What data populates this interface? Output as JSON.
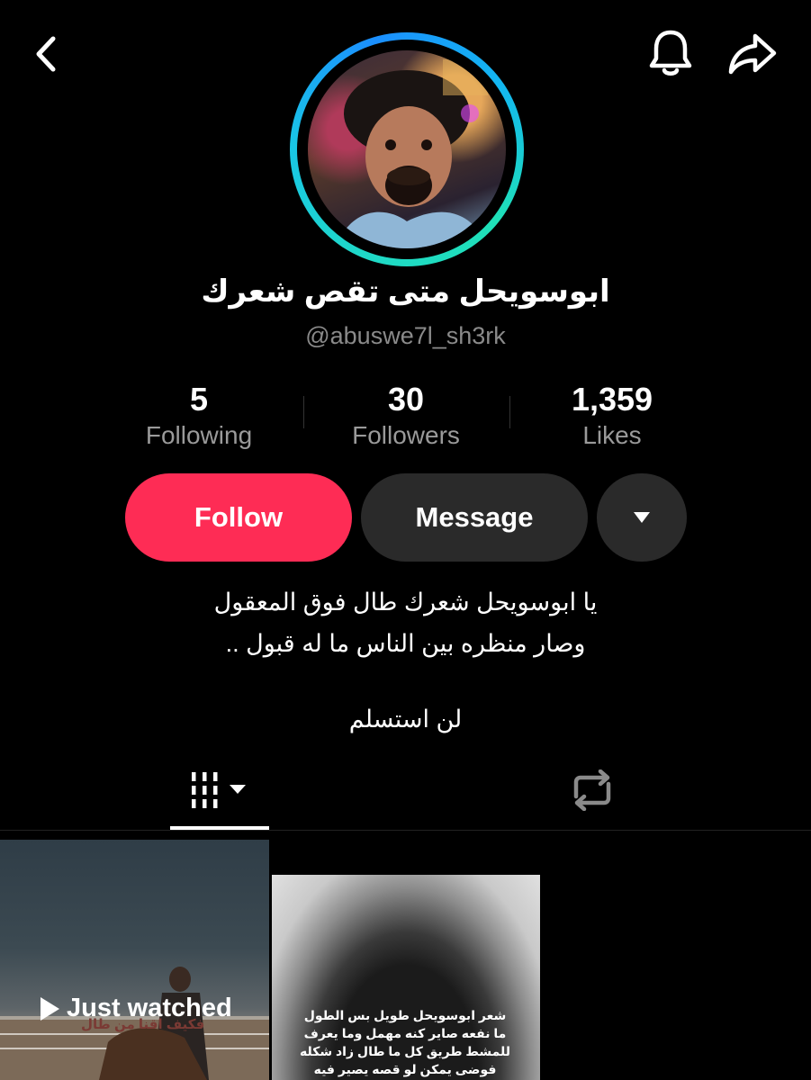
{
  "header": {
    "back_icon": "chevron-left-icon",
    "bell_icon": "bell-icon",
    "share_icon": "share-arrow-icon"
  },
  "profile": {
    "display_name": "ابوسويحل متى تقص شعرك",
    "handle": "@abuswe7l_sh3rk"
  },
  "stats": [
    {
      "value": "5",
      "label": "Following"
    },
    {
      "value": "30",
      "label": "Followers"
    },
    {
      "value": "1,359",
      "label": "Likes"
    }
  ],
  "actions": {
    "follow_label": "Follow",
    "message_label": "Message",
    "more_icon": "caret-down-icon"
  },
  "bio": {
    "line1": "يا ابوسويحل شعرك طال فوق المعقول",
    "line2": "وصار منظره بين الناس ما له قبول ..",
    "line3": "لن استسلم"
  },
  "tabs": {
    "videos_icon": "video-grid-icon",
    "reposts_icon": "repost-icon"
  },
  "videos": {
    "just_watched_label": "Just watched",
    "thumb1_overlay": "فكيف اقنا من طال",
    "thumb2_caption": [
      "شعر ابوسويحل طويل بس الطول",
      "ما نفعه صاير كنه مهمل وما يعرف",
      "للمشط طريق كل ما طال زاد شكله",
      "فوضى يمكن لو قصه يصير فيه"
    ]
  },
  "colors": {
    "follow": "#fe2c55",
    "button_dark": "#2a2a2a",
    "ring": "#19c6e6"
  }
}
